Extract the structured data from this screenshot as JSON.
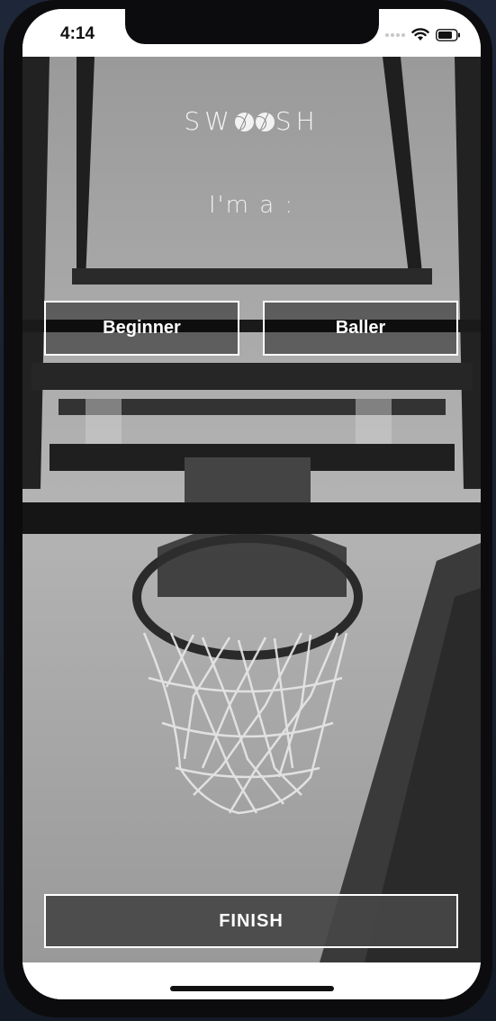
{
  "status_bar": {
    "time": "4:14"
  },
  "app": {
    "logo_prefix": "SW",
    "logo_suffix": "SH",
    "prompt": "I'm a :"
  },
  "options": {
    "beginner_label": "Beginner",
    "baller_label": "Baller"
  },
  "actions": {
    "finish_label": "FINISH"
  },
  "colors": {
    "button_border": "#ffffff",
    "finish_background": "#464646",
    "overlay_text": "#ffffff"
  },
  "icons": [
    "signal-dots-icon",
    "wifi-icon",
    "battery-icon",
    "basketball-icon"
  ]
}
